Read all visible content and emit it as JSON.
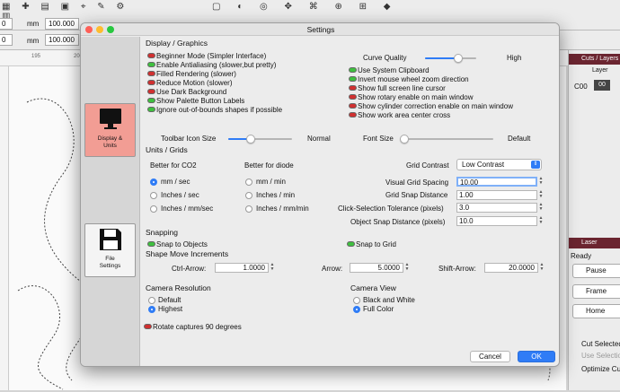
{
  "background_app": {
    "toolbar_field_1": "0",
    "toolbar_unit_1": "mm",
    "toolbar_field_2": "100.000",
    "toolbar_field_3": "0",
    "toolbar_unit_3": "mm",
    "toolbar_field_4": "100.000",
    "ruler_mark_195": "195",
    "ruler_mark_200": "200",
    "cuts_layers_title": "Cuts / Layers",
    "layer_col": "Layer",
    "layer_row": "C00",
    "layer_row_num": "00",
    "laser_title": "Laser",
    "laser_status": "Ready",
    "pause_btn": "Pause",
    "frame_btn": "Frame",
    "home_btn": "Home",
    "cut_selected": "Cut Selected",
    "use_selection": "Use Selection",
    "optimize": "Optimize Cut"
  },
  "dialog": {
    "title": "Settings",
    "nav": [
      {
        "label": "Display & Units"
      },
      {
        "label": "File Settings"
      }
    ],
    "display": {
      "header": "Display / Graphics",
      "left_toggles": [
        {
          "label": "Beginner Mode (Simpler Interface)",
          "on": false
        },
        {
          "label": "Enable Antialiasing (slower,but pretty)",
          "on": true
        },
        {
          "label": "Filled Rendering (slower)",
          "on": false
        },
        {
          "label": "Reduce Motion (slower)",
          "on": false
        },
        {
          "label": "Use Dark Background",
          "on": false
        },
        {
          "label": "Show Palette Button Labels",
          "on": true
        },
        {
          "label": "Ignore out-of-bounds shapes if possible",
          "on": true
        }
      ],
      "curve_quality_label": "Curve Quality",
      "curve_quality_value": "High",
      "right_toggles": [
        {
          "label": "Use System Clipboard",
          "on": true
        },
        {
          "label": "Invert mouse wheel zoom direction",
          "on": true
        },
        {
          "label": "Show full screen line cursor",
          "on": false
        },
        {
          "label": "Show rotary enable on main window",
          "on": false
        },
        {
          "label": "Show cylinder correction enable on main window",
          "on": false
        },
        {
          "label": "Show work area center cross",
          "on": false
        }
      ],
      "toolbar_icon_size_label": "Toolbar Icon Size",
      "toolbar_icon_size_value": "Normal",
      "font_size_label": "Font Size",
      "font_size_value": "Default"
    },
    "units": {
      "header": "Units / Grids",
      "co2_header": "Better for CO2",
      "co2_options": [
        "mm / sec",
        "Inches / sec",
        "Inches / mm/sec"
      ],
      "diode_header": "Better for diode",
      "diode_options": [
        "mm / min",
        "Inches / min",
        "Inches / mm/min"
      ],
      "grid_contrast_label": "Grid Contrast",
      "grid_contrast_value": "Low Contrast",
      "visual_grid_label": "Visual Grid Spacing",
      "visual_grid_value": "10.00",
      "grid_snap_label": "Grid Snap Distance",
      "grid_snap_value": "1.00",
      "click_tol_label": "Click-Selection Tolerance (pixels)",
      "click_tol_value": "3.0",
      "object_snap_label": "Object Snap Distance (pixels)",
      "object_snap_value": "10.0"
    },
    "snapping": {
      "header": "Snapping",
      "snap_objects": "Snap to Objects",
      "snap_grid": "Snap to Grid",
      "move_header": "Shape Move Increments",
      "ctrl_arrow_label": "Ctrl-Arrow:",
      "ctrl_arrow_value": "1.0000",
      "arrow_label": "Arrow:",
      "arrow_value": "5.0000",
      "shift_arrow_label": "Shift-Arrow:",
      "shift_arrow_value": "20.0000"
    },
    "camera": {
      "resolution_header": "Camera Resolution",
      "res_default": "Default",
      "res_highest": "Highest",
      "view_header": "Camera View",
      "view_bw": "Black and White",
      "view_color": "Full Color",
      "rotate_label": "Rotate captures 90 degrees"
    },
    "cancel_label": "Cancel",
    "ok_label": "OK"
  },
  "colors": {
    "accent": "#2f7cf6",
    "toggle_on": "#3fbf3f",
    "toggle_off": "#d03030",
    "layer_header": "#6b2530"
  }
}
